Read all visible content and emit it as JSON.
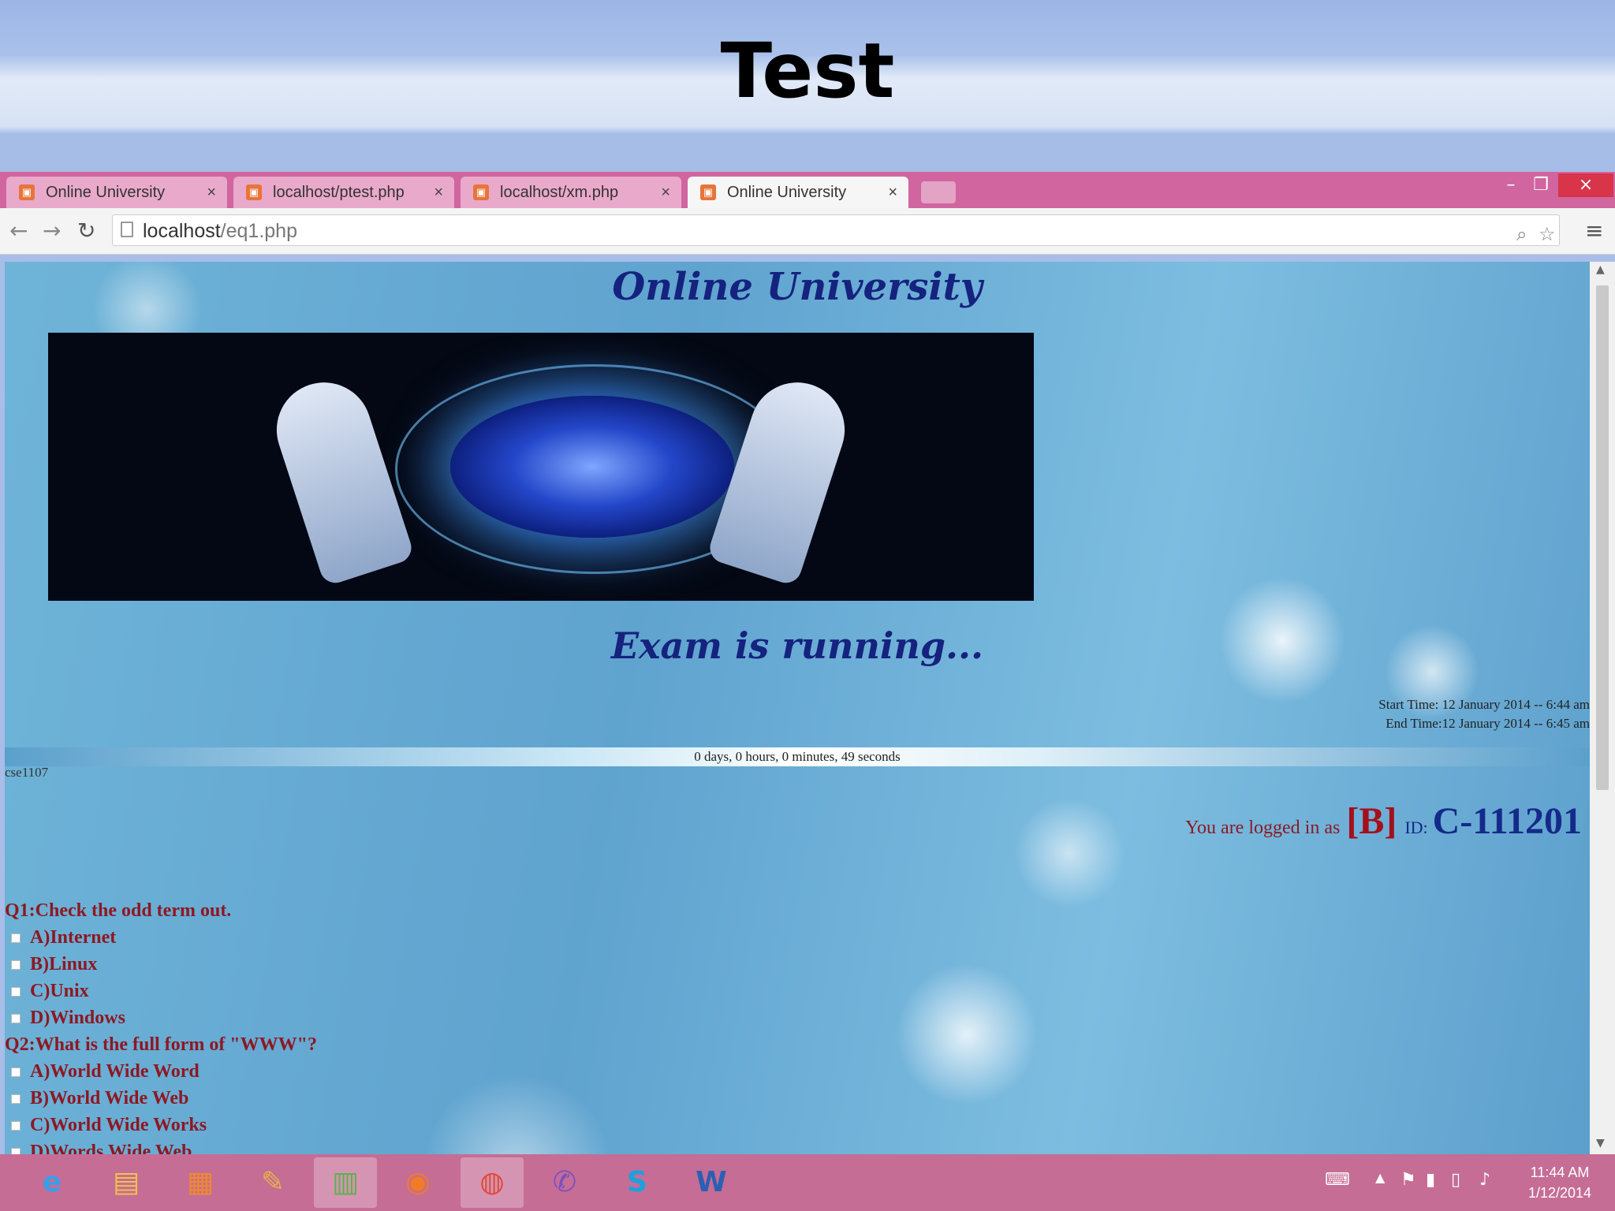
{
  "slide": {
    "title": "Test"
  },
  "browser": {
    "tabs": [
      {
        "label": "Online University"
      },
      {
        "label": "localhost/ptest.php"
      },
      {
        "label": "localhost/xm.php"
      },
      {
        "label": "Online University"
      }
    ],
    "url_host": "localhost",
    "url_path": "/eq1.php"
  },
  "page": {
    "site_title": "Online University",
    "status": "Exam is running...",
    "start_time": "Start Time: 12 January 2014 -- 6:44 am",
    "end_time": "End Time:12 January 2014 -- 6:45 am",
    "countdown": "0 days, 0 hours, 0 minutes, 49 seconds",
    "user_code": "cse1107",
    "login": {
      "text": "You are logged in as",
      "role": "[B]",
      "id_label": "ID:",
      "id": "C-111201"
    },
    "questions": [
      {
        "question": "Q1:Check the odd term out.",
        "options": [
          "A)Internet",
          "B)Linux",
          "C)Unix",
          "D)Windows"
        ]
      },
      {
        "question": "Q2:What is the full form of \"WWW\"?",
        "options": [
          "A)World Wide Word",
          "B)World Wide Web",
          "C)World Wide Works",
          "D)Words Wide Web"
        ]
      }
    ]
  },
  "taskbar": {
    "clock_time": "11:44 AM",
    "clock_date": "1/12/2014",
    "apps": [
      "internet-explorer-icon",
      "file-explorer-icon",
      "store-icon",
      "paint-icon",
      "project-icon",
      "firefox-icon",
      "chrome-icon",
      "viber-icon",
      "skype-icon",
      "word-icon"
    ]
  },
  "colors": {
    "tabbar": "#d1659f",
    "taskbar": "#c56d95",
    "heading_blue": "#15227e",
    "question_red": "#8e1822"
  }
}
